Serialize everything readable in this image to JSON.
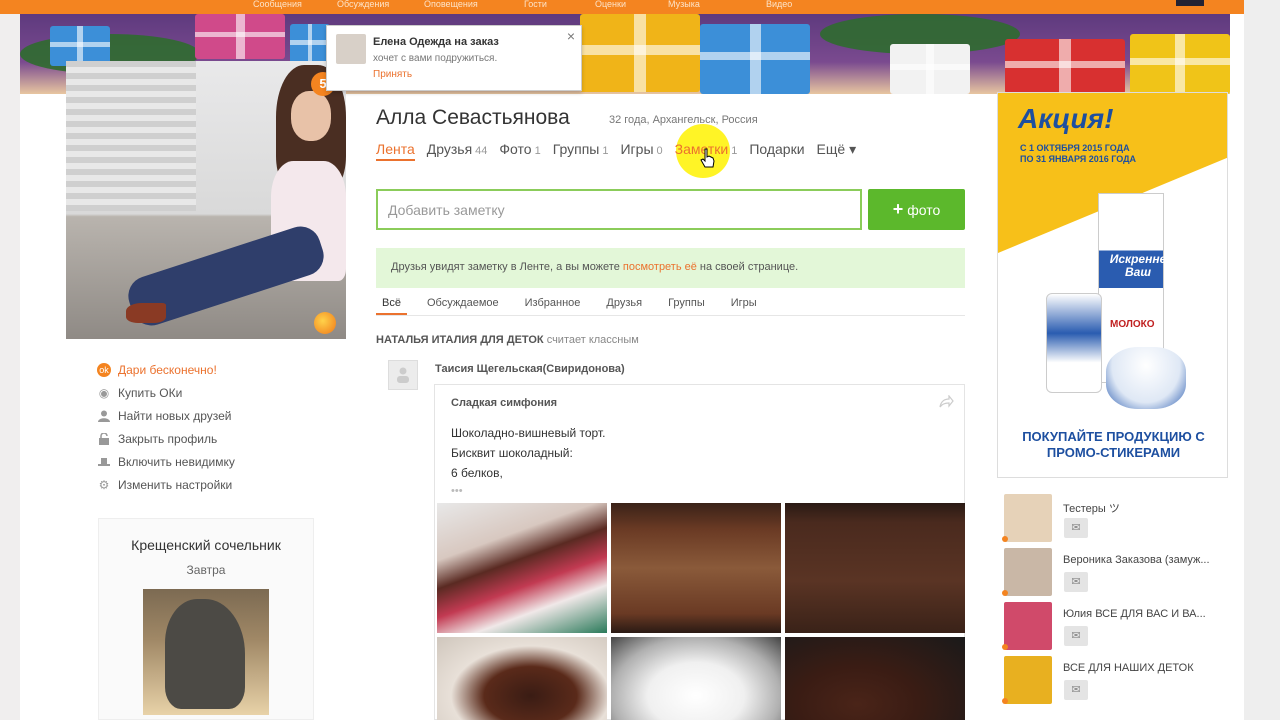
{
  "topnav": {
    "logo": "",
    "items": [
      "Сообщения",
      "Обсуждения",
      "Оповещения",
      "Гости",
      "Оценки",
      "Музыка",
      "Видео"
    ]
  },
  "notification": {
    "name": "Елена Одежда на заказ",
    "text": "хочет с вами подружиться.",
    "accept": "Принять",
    "close": "×"
  },
  "profile": {
    "name": "Алла Севастьянова",
    "meta": "32 года, Архангельск, Россия",
    "badge": "5"
  },
  "tabs": [
    {
      "label": "Лента",
      "count": ""
    },
    {
      "label": "Друзья",
      "count": "44"
    },
    {
      "label": "Фото",
      "count": "1"
    },
    {
      "label": "Группы",
      "count": "1"
    },
    {
      "label": "Игры",
      "count": "0"
    },
    {
      "label": "Заметки",
      "count": "1"
    },
    {
      "label": "Подарки",
      "count": ""
    },
    {
      "label": "Ещё ▾",
      "count": ""
    }
  ],
  "note": {
    "placeholder": "Добавить заметку",
    "photo_button": "фото",
    "photo_plus": "+"
  },
  "info": {
    "before": "Друзья увидят заметку в Ленте, а вы можете ",
    "link": "посмотреть её",
    "after": " на своей странице."
  },
  "filters": [
    "Всё",
    "Обсуждаемое",
    "Избранное",
    "Друзья",
    "Группы",
    "Игры"
  ],
  "left_menu": [
    {
      "label": "Дари бесконечно!",
      "icon": "gift-icon",
      "glyph": "ok"
    },
    {
      "label": "Купить ОКи",
      "icon": "coin-icon",
      "glyph": "◉"
    },
    {
      "label": "Найти новых друзей",
      "icon": "user-icon",
      "glyph": "👤"
    },
    {
      "label": "Закрыть профиль",
      "icon": "lock-icon",
      "glyph": "🔓"
    },
    {
      "label": "Включить невидимку",
      "icon": "hat-icon",
      "glyph": "▬"
    },
    {
      "label": "Изменить настройки",
      "icon": "gear-icon",
      "glyph": "⚙"
    }
  ],
  "holiday": {
    "title": "Крещенский сочельник",
    "subtitle": "Завтра"
  },
  "feed": {
    "group": "НАТАЛЬЯ ИТАЛИЯ ДЛЯ ДЕТОК",
    "action": "считает классным",
    "author": "Таисия Щегельская(Свиридонова)",
    "post_title": "Сладкая симфония",
    "lines": [
      "Шоколадно-вишневый торт.",
      "Бисквит шоколадный:",
      "6 белков,"
    ],
    "more": "•••"
  },
  "ad": {
    "title": "Акция!",
    "dates": "С 1 ОКТЯБРЯ 2015 ГОДА ПО 31 ЯНВАРЯ 2016 ГОДА",
    "brand": "Искренне Ваш",
    "milk": "МОЛОКО",
    "bottom": "ПОКУПАЙТЕ ПРОДУКЦИЮ С ПРОМО-СТИКЕРАМИ"
  },
  "friends": [
    {
      "name": "Тестеры ツ",
      "color": "#e6d2b8"
    },
    {
      "name": "Вероника Заказова (замуж...",
      "color": "#c9b7a6"
    },
    {
      "name": "Юлия ВСЕ ДЛЯ ВАС И ВА...",
      "color": "#d04a6a"
    },
    {
      "name": "ВСЕ ДЛЯ НАШИХ ДЕТОК",
      "color": "#e8b020"
    }
  ],
  "colors": {
    "accent": "#eb722e",
    "topbar": "#f48420",
    "green": "#5cb82c"
  }
}
